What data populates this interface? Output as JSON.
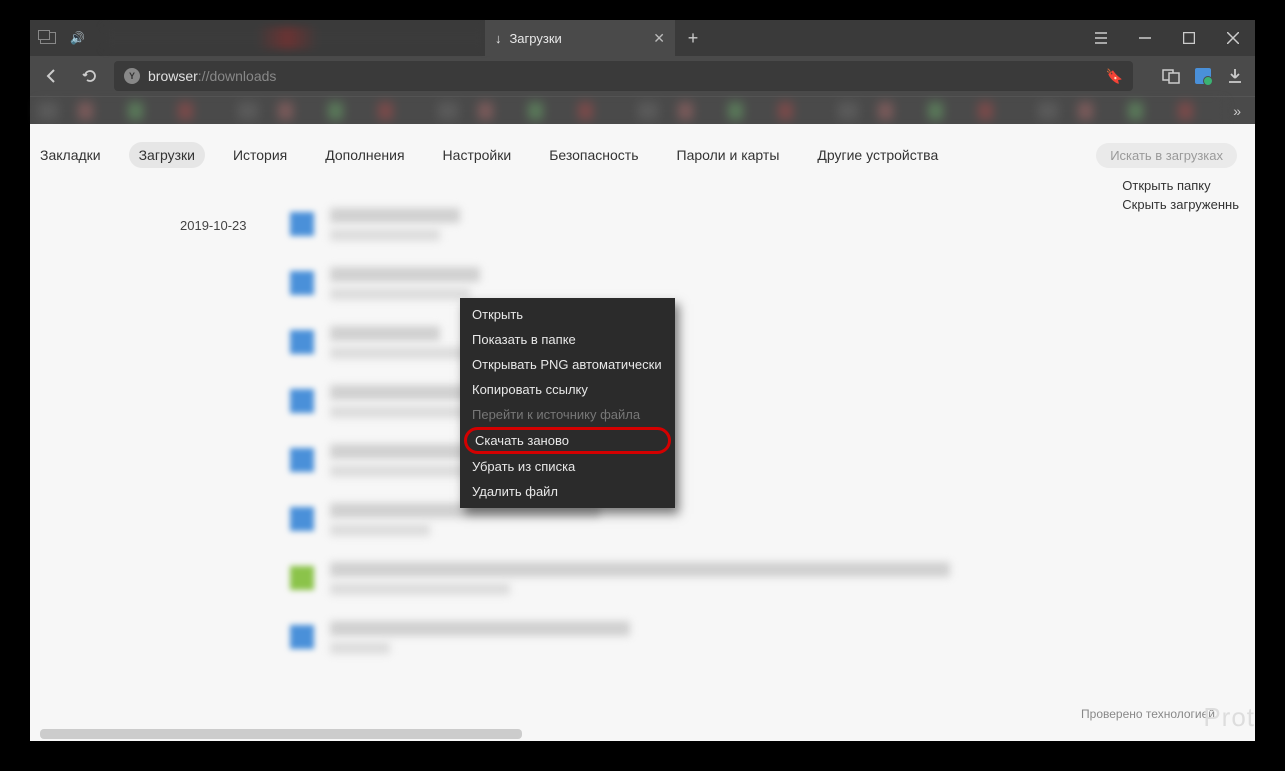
{
  "tab": {
    "title": "Загрузки",
    "icon": "↓"
  },
  "addr": {
    "protocol": "browser",
    "path": "://downloads"
  },
  "menu": {
    "items": [
      {
        "label": "Закладки",
        "active": false
      },
      {
        "label": "Загрузки",
        "active": true
      },
      {
        "label": "История",
        "active": false
      },
      {
        "label": "Дополнения",
        "active": false
      },
      {
        "label": "Настройки",
        "active": false
      },
      {
        "label": "Безопасность",
        "active": false
      },
      {
        "label": "Пароли и карты",
        "active": false
      },
      {
        "label": "Другие устройства",
        "active": false
      }
    ],
    "search_placeholder": "Искать в загрузках"
  },
  "date_header": "2019-10-23",
  "side_links": {
    "open_folder": "Открыть папку",
    "hide_downloaded": "Скрыть загруженнь"
  },
  "context_menu": {
    "open": "Открыть",
    "show_in_folder": "Показать в папке",
    "open_png_auto": "Открывать PNG автоматически",
    "copy_link": "Копировать ссылку",
    "go_to_source": "Перейти к источнику файла",
    "download_again": "Скачать заново",
    "remove_from_list": "Убрать из списка",
    "delete_file": "Удалить файл"
  },
  "footer": {
    "checked_by": "Проверено технологией",
    "brand": "Prot"
  },
  "downloads_list": [
    {
      "icon_color": "blue",
      "name_width": 130,
      "meta_width": 110
    },
    {
      "icon_color": "blue",
      "name_width": 150,
      "meta_width": 140
    },
    {
      "icon_color": "blue",
      "name_width": 110,
      "meta_width": 140
    },
    {
      "icon_color": "blue",
      "name_width": 200,
      "meta_width": 160
    },
    {
      "icon_color": "blue",
      "name_width": 300,
      "meta_width": 260
    },
    {
      "icon_color": "blue",
      "name_width": 270,
      "meta_width": 100
    },
    {
      "icon_color": "green",
      "name_width": 620,
      "meta_width": 180
    },
    {
      "icon_color": "blue",
      "name_width": 300,
      "meta_width": 60
    }
  ]
}
